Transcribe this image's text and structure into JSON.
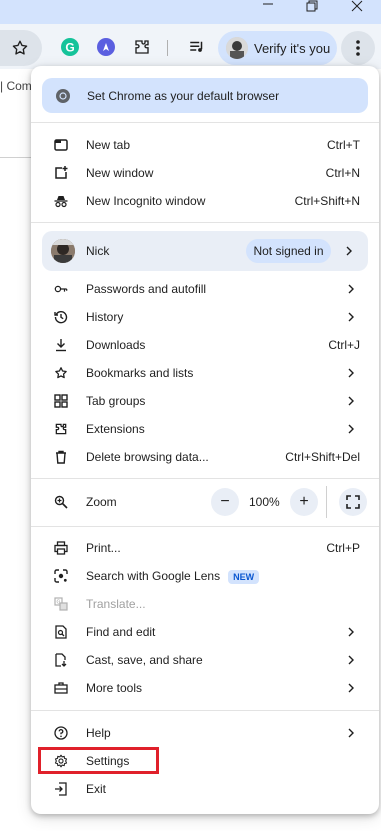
{
  "browser": {
    "profile_chip": {
      "label": "Verify it's you"
    },
    "bookmarks_bar": {
      "partial_text": "| Com"
    }
  },
  "menu": {
    "default_banner": {
      "label": "Set Chrome as your default browser"
    },
    "group1": [
      {
        "label": "New tab",
        "shortcut": "Ctrl+T",
        "icon": "new-tab-icon"
      },
      {
        "label": "New window",
        "shortcut": "Ctrl+N",
        "icon": "new-window-icon"
      },
      {
        "label": "New Incognito window",
        "shortcut": "Ctrl+Shift+N",
        "icon": "incognito-icon"
      }
    ],
    "profile": {
      "name": "Nick",
      "status": "Not signed in"
    },
    "group2": [
      {
        "label": "Passwords and autofill",
        "icon": "key-icon",
        "submenu": true
      },
      {
        "label": "History",
        "icon": "history-icon",
        "submenu": true
      },
      {
        "label": "Downloads",
        "shortcut": "Ctrl+J",
        "icon": "download-icon"
      },
      {
        "label": "Bookmarks and lists",
        "icon": "star-icon",
        "submenu": true
      },
      {
        "label": "Tab groups",
        "icon": "tab-groups-icon",
        "submenu": true
      },
      {
        "label": "Extensions",
        "icon": "puzzle-icon",
        "submenu": true
      },
      {
        "label": "Delete browsing data...",
        "shortcut": "Ctrl+Shift+Del",
        "icon": "trash-icon"
      }
    ],
    "zoom": {
      "label": "Zoom",
      "value": "100%",
      "minus": "−",
      "plus": "+"
    },
    "group3": [
      {
        "label": "Print...",
        "shortcut": "Ctrl+P",
        "icon": "print-icon"
      },
      {
        "label": "Search with Google Lens",
        "badge": "NEW",
        "icon": "lens-icon"
      },
      {
        "label": "Translate...",
        "icon": "translate-icon",
        "disabled": true
      },
      {
        "label": "Find and edit",
        "icon": "find-icon",
        "submenu": true
      },
      {
        "label": "Cast, save, and share",
        "icon": "cast-icon",
        "submenu": true
      },
      {
        "label": "More tools",
        "icon": "toolbox-icon",
        "submenu": true
      }
    ],
    "group4": [
      {
        "label": "Help",
        "icon": "help-icon",
        "submenu": true
      },
      {
        "label": "Settings",
        "icon": "gear-icon",
        "highlighted": true
      },
      {
        "label": "Exit",
        "icon": "exit-icon"
      }
    ]
  },
  "colors": {
    "accent": "#d3e3fd",
    "highlight_box": "#e0202a",
    "badge_text": "#0b57d0"
  }
}
